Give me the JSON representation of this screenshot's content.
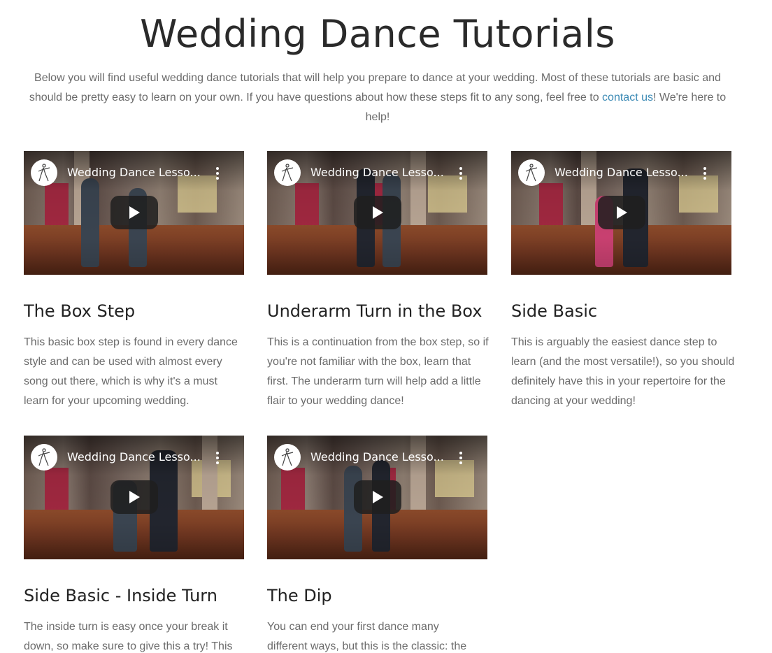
{
  "page": {
    "title": "Wedding Dance Tutorials",
    "intro_before_link": "Below you will find useful wedding dance tutorials that will help you prepare to dance at your wedding. Most of these tutorials are basic and should be pretty easy to learn on your own. If you have questions about how these steps fit to any song, feel free to ",
    "intro_link": "contact us",
    "intro_after_link": "! We're here to help!"
  },
  "colors": {
    "link": "#3b8ab5",
    "title_text": "#222222",
    "body_text": "#6b6b6b"
  },
  "tutorials": [
    {
      "video_title": "Wedding Dance Lesso...",
      "title": "The Box Step",
      "description": "This basic box step is found in every dance style and can be used with almost every song out there, which is why it's a must learn for your upcoming wedding."
    },
    {
      "video_title": "Wedding Dance Lesso...",
      "title": "Underarm Turn in the Box",
      "description": "This is a continuation from the box step, so if you're not familiar with the box, learn that first. The underarm turn will help add a little flair to your wedding dance!"
    },
    {
      "video_title": "Wedding Dance Lesso...",
      "title": "Side Basic",
      "description": "This is arguably the easiest dance step to learn (and the most versatile!), so you should definitely have this in your repertoire for the dancing at your wedding!"
    },
    {
      "video_title": "Wedding Dance Lesso...",
      "title": "Side Basic - Inside Turn",
      "description": "The inside turn is easy once your break it down, so make sure to give this a try! This"
    },
    {
      "video_title": "Wedding Dance Lesso...",
      "title": "The Dip",
      "description": "You can end your first dance many different ways, but this is the classic: the"
    }
  ],
  "icons": {
    "channel_logo": "dancer-silhouette-icon",
    "menu": "kebab-menu-icon",
    "play": "play-icon"
  }
}
